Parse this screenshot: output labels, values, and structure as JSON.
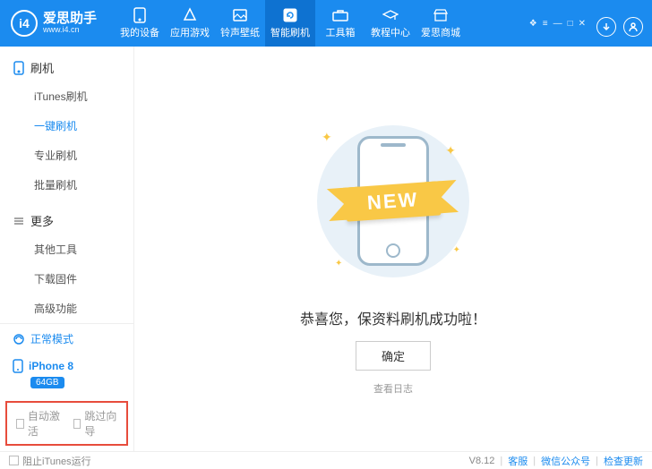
{
  "header": {
    "brand": "爱思助手",
    "url": "www.i4.cn",
    "nav": [
      {
        "label": "我的设备"
      },
      {
        "label": "应用游戏"
      },
      {
        "label": "铃声壁纸"
      },
      {
        "label": "智能刷机"
      },
      {
        "label": "工具箱"
      },
      {
        "label": "教程中心"
      },
      {
        "label": "爱思商城"
      }
    ],
    "active_nav": 3
  },
  "sidebar": {
    "section1_title": "刷机",
    "section1_items": [
      "iTunes刷机",
      "一键刷机",
      "专业刷机",
      "批量刷机"
    ],
    "section1_active": 1,
    "section2_title": "更多",
    "section2_items": [
      "其他工具",
      "下载固件",
      "高级功能"
    ],
    "mode_label": "正常模式",
    "device_name": "iPhone 8",
    "device_storage": "64GB",
    "check1_label": "自动激活",
    "check2_label": "跳过向导"
  },
  "main": {
    "ribbon_text": "NEW",
    "success_text": "恭喜您，保资料刷机成功啦！",
    "ok_label": "确定",
    "log_label": "查看日志"
  },
  "footer": {
    "prevent_itunes": "阻止iTunes运行",
    "version": "V8.12",
    "support": "客服",
    "wechat": "微信公众号",
    "update": "检查更新"
  }
}
